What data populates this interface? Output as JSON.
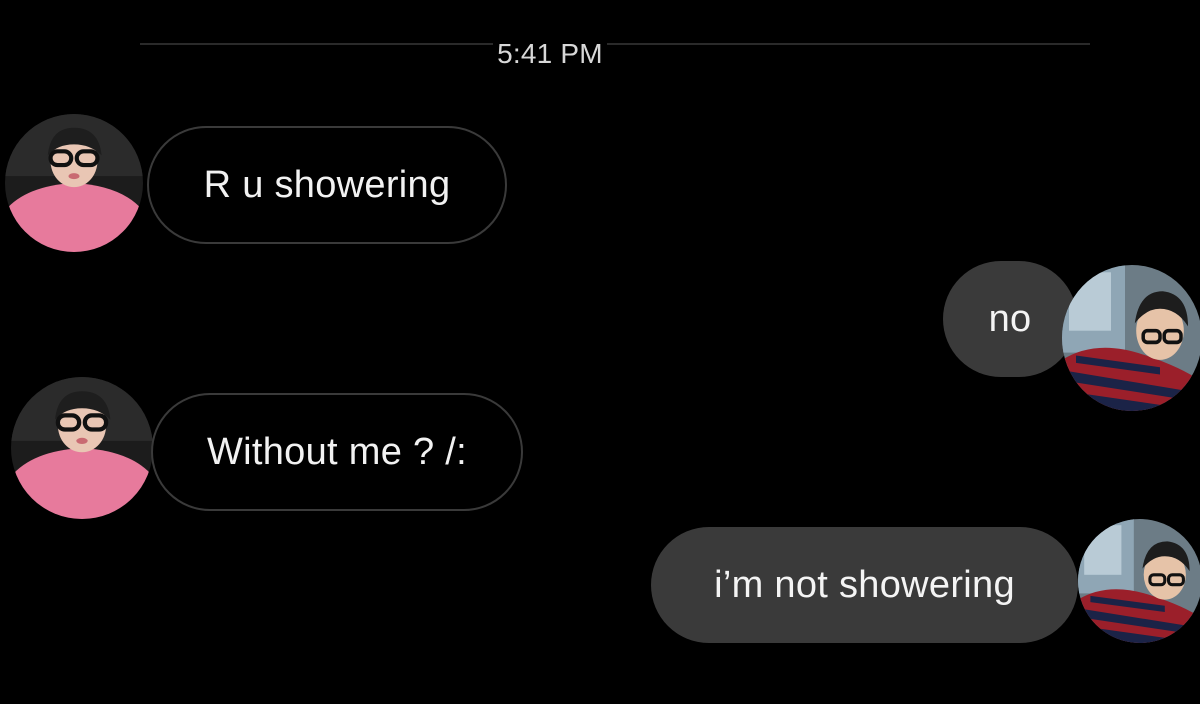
{
  "conversation": {
    "timestamp": "5:41 PM",
    "messages": [
      {
        "direction": "incoming",
        "text": "R u showering",
        "avatar": "pink-sweater-glasses-avatar"
      },
      {
        "direction": "outgoing",
        "text": "no",
        "avatar": "striped-shirt-glasses-avatar"
      },
      {
        "direction": "incoming",
        "text": "Without me ? /:",
        "avatar": "pink-sweater-glasses-avatar"
      },
      {
        "direction": "outgoing",
        "text": "i’m not showering",
        "avatar": "striped-shirt-glasses-avatar"
      }
    ]
  },
  "colors": {
    "background": "#000000",
    "incoming_border": "#3a3a3a",
    "outgoing_fill": "#3a3a3a",
    "text": "#f2f2f2"
  }
}
